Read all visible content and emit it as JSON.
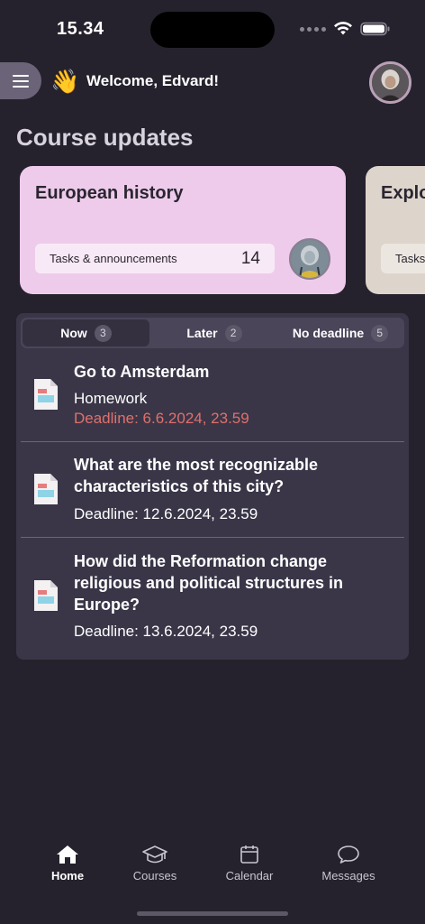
{
  "status_bar": {
    "time": "15.34"
  },
  "header": {
    "welcome": "Welcome, Edvard!",
    "wave_emoji": "👋"
  },
  "section_title": "Course updates",
  "courses": [
    {
      "title": "European history",
      "pill_label": "Tasks & announcements",
      "pill_count": "14"
    },
    {
      "title": "Explo",
      "pill_label": "Tasks"
    }
  ],
  "tabs": [
    {
      "label": "Now",
      "count": "3"
    },
    {
      "label": "Later",
      "count": "2"
    },
    {
      "label": "No deadline",
      "count": "5"
    }
  ],
  "tasks": [
    {
      "title": "Go to Amsterdam",
      "type": "Homework",
      "deadline": "Deadline: 6.6.2024, 23.59"
    },
    {
      "title": "What are the most recognizable characteristics of this city?",
      "deadline": "Deadline: 12.6.2024, 23.59"
    },
    {
      "title": "How did the Reformation change religious and political structures in Europe?",
      "deadline": "Deadline: 13.6.2024, 23.59"
    }
  ],
  "nav": {
    "home": "Home",
    "courses": "Courses",
    "calendar": "Calendar",
    "messages": "Messages"
  },
  "colors": {
    "background": "#25222d",
    "card_european_history": "#eecbeb",
    "card_second": "#ddd4cc",
    "panel": "#3a3648",
    "deadline_overdue": "#e0706b"
  }
}
